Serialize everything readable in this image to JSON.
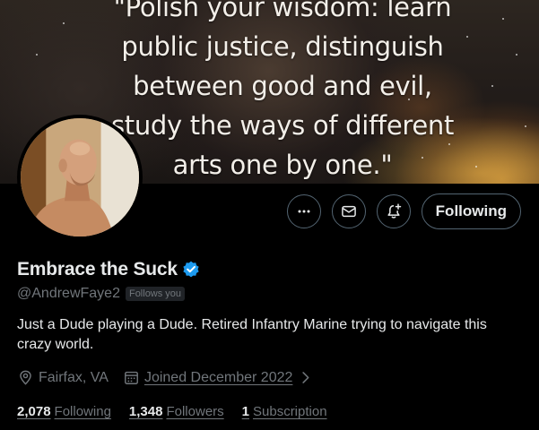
{
  "banner": {
    "quote_lines": [
      "\"Polish your wisdom: learn",
      "public justice, distinguish",
      "between good and evil,",
      "study the ways of different",
      "arts one by one.\""
    ]
  },
  "actions": {
    "more_icon": "more-icon",
    "message_icon": "mail-icon",
    "notify_icon": "bell-plus-icon",
    "follow_label": "Following"
  },
  "profile": {
    "display_name": "Embrace the Suck",
    "verified": true,
    "handle": "@AndrewFaye2",
    "follows_you_badge": "Follows you",
    "bio": "Just a Dude playing a Dude. Retired Infantry Marine trying to navigate this crazy world.",
    "location": "Fairfax, VA",
    "joined": "Joined December 2022"
  },
  "stats": {
    "following_count": "2,078",
    "following_label": "Following",
    "followers_count": "1,348",
    "followers_label": "Followers",
    "subscription_count": "1",
    "subscription_label": "Subscription"
  },
  "colors": {
    "background": "#000000",
    "text_primary": "#e7e9ea",
    "text_secondary": "#71767b",
    "border": "#536471",
    "verified_blue": "#1d9bf0"
  }
}
